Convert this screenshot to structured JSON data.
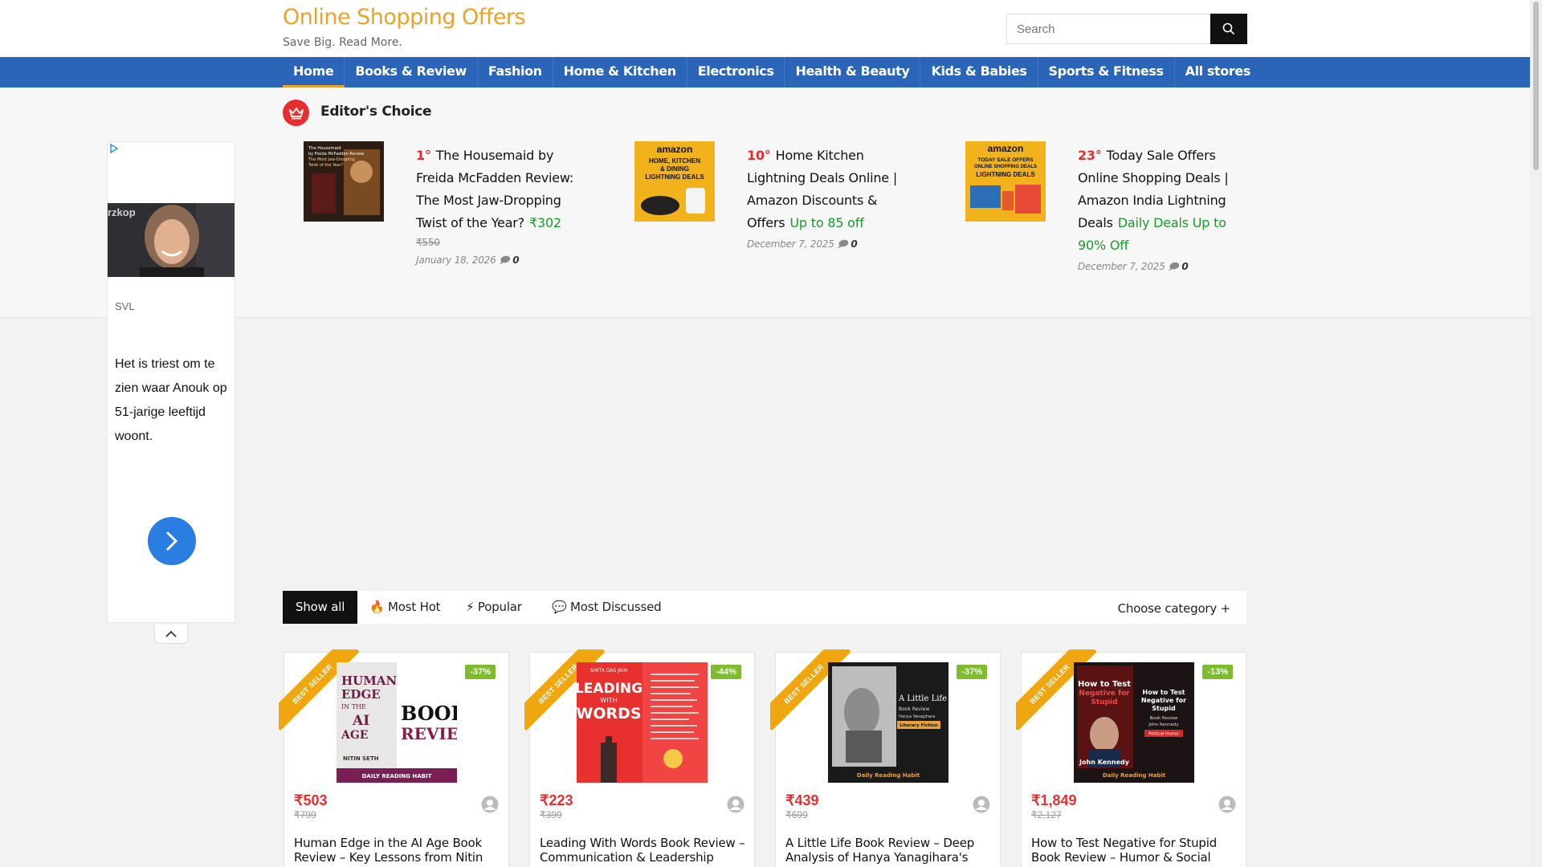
{
  "site": {
    "title": "Online Shopping Offers",
    "tagline": "Save Big. Read More."
  },
  "search": {
    "placeholder": "Search"
  },
  "nav": [
    "Home",
    "Books & Review",
    "Fashion",
    "Home & Kitchen",
    "Electronics",
    "Health & Beauty",
    "Kids & Babies",
    "Sports & Fitness",
    "All stores"
  ],
  "editors_choice": {
    "heading": "Editor's Choice",
    "items": [
      {
        "rank": "1°",
        "title": "The Housemaid by Freida McFadden Review: The Most Jaw-Dropping Twist of the Year?",
        "price": "₹302",
        "old_price": "₹550",
        "date": "January 18, 2026",
        "comments": "0"
      },
      {
        "rank": "10°",
        "title": "Home Kitchen Lightning Deals Online | Amazon Discounts & Offers",
        "price": "Up to 85 off",
        "old_price": "",
        "date": "December 7, 2025",
        "comments": "0"
      },
      {
        "rank": "23°",
        "title": "Today Sale Offers Online Shopping Deals | Amazon India Lightning Deals",
        "price": "Daily Deals Up to 90% Off",
        "old_price": "",
        "date": "December 7, 2025",
        "comments": "0"
      }
    ],
    "thumbs": [
      {
        "line1": "The Housemaid",
        "line2": "by Freida McFadden Review",
        "line3": "The Most Jaw-Dropping",
        "line4": "Twist of the Year?"
      },
      {
        "brand": "amazon",
        "l1": "HOME, KITCHEN",
        "l2": "& DINING",
        "l3": "LIGHTNING DEALS"
      },
      {
        "brand": "amazon",
        "l1": "TODAY SALE OFFERS",
        "l2": "ONLINE SHOPPING DEALS",
        "l3": "LIGHTNING DEALS"
      }
    ]
  },
  "ad": {
    "source": "SVL",
    "text": "Het is triest om te zien waar Anouk op 51-jarige leeftijd woont.",
    "photo_text": "rzkop"
  },
  "filter": {
    "tabs": [
      "Show all",
      "🔥 Most Hot",
      "⚡ Popular",
      "💬 Most Discussed"
    ],
    "category": "Choose category +"
  },
  "products": [
    {
      "badge": "BEST SELLER",
      "discount": "-37%",
      "price": "₹503",
      "old_price": "₹799",
      "title": "Human Edge in the AI Age Book Review – Key Lessons from Nitin",
      "cover": {
        "t1": "HUMAN",
        "t2": "EDGE",
        "t3": "IN THE",
        "t4": "AI",
        "t5": "AGE",
        "t6": "BOOK",
        "t7": "REVIEW",
        "author": "NITIN SETH",
        "foot": "DAILY READING HABIT"
      }
    },
    {
      "badge": "BEST SELLER",
      "discount": "-44%",
      "price": "₹223",
      "old_price": "₹399",
      "title": "Leading With Words Book Review – Communication & Leadership",
      "cover": {
        "author": "SMITA DAS JAIN",
        "t1": "LEADING",
        "t2": "WITH",
        "t3": "WORDS"
      }
    },
    {
      "badge": "BEST SELLER",
      "discount": "-37%",
      "price": "₹439",
      "old_price": "₹699",
      "title": "A Little Life Book Review – Deep Analysis of Hanya Yanagihara's",
      "cover": {
        "t1": "A Little Life",
        "t2": "Book Review",
        "t3": "Hanya Yanagihara",
        "t4": "Literary Fiction",
        "foot": "Daily Reading Habit"
      }
    },
    {
      "badge": "BEST SELLER",
      "discount": "-13%",
      "price": "₹1,849",
      "old_price": "₹2,127",
      "title": "How to Test Negative for Stupid Book Review – Humor & Social",
      "cover": {
        "t1": "How to Test",
        "t2": "Negative for",
        "t3": "Stupid",
        "t4": "Book Review",
        "t5": "John Kennedy",
        "t6": "Political Humor",
        "author": "John Kennedy",
        "foot": "Daily Reading Habit"
      }
    }
  ]
}
